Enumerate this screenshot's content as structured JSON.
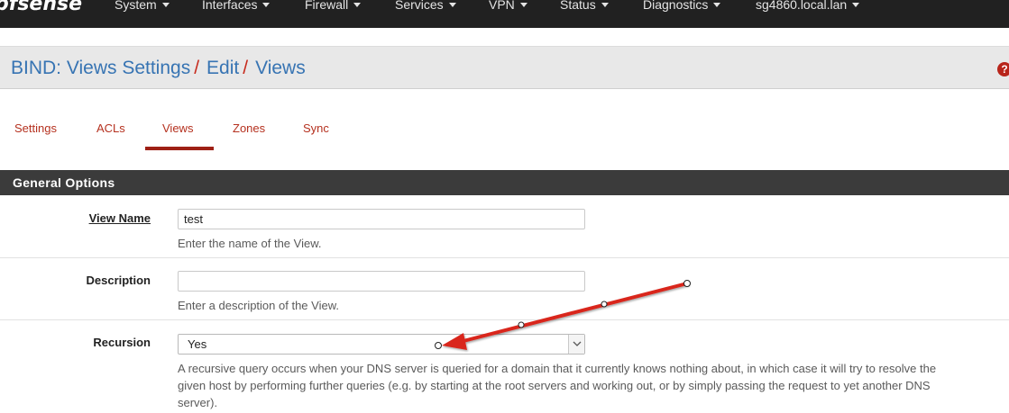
{
  "navbar": {
    "logo_text": "pfsense",
    "items": [
      {
        "label": "System"
      },
      {
        "label": "Interfaces"
      },
      {
        "label": "Firewall"
      },
      {
        "label": "Services"
      },
      {
        "label": "VPN"
      },
      {
        "label": "Status"
      },
      {
        "label": "Diagnostics"
      },
      {
        "label": "sg4860.local.lan"
      }
    ]
  },
  "breadcrumb": {
    "items": [
      "BIND: Views Settings",
      "Edit",
      "Views"
    ],
    "separator": "/",
    "help_icon": "question-circle-icon"
  },
  "tabs": [
    {
      "label": "Settings"
    },
    {
      "label": "ACLs"
    },
    {
      "label": "Views",
      "active": true
    },
    {
      "label": "Zones"
    },
    {
      "label": "Sync"
    }
  ],
  "section": {
    "title": "General Options"
  },
  "form": {
    "view_name": {
      "label": "View Name",
      "value": "test",
      "help": "Enter the name of the View."
    },
    "description": {
      "label": "Description",
      "value": "",
      "help": "Enter a description of the View."
    },
    "recursion": {
      "label": "Recursion",
      "value": "Yes",
      "help_line1": "A recursive query occurs when your DNS server is queried for a domain that it currently knows nothing about,  in which case it will try to resolve the",
      "help_line2": "given host by performing further queries  (e.g. by starting at the root servers and working out, or by simply passing the request to yet another DNS",
      "help_line3": "server)."
    }
  },
  "colors": {
    "navbar_bg": "#212121",
    "link_blue": "#3774b3",
    "tab_red": "#b5311f",
    "section_bg": "#3b3b3b",
    "arrow_red": "#d9261c"
  }
}
